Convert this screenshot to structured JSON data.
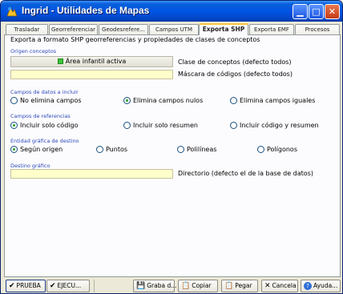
{
  "window": {
    "title": "Ingrid - Utilidades de Mapas",
    "controls": [
      "minimize",
      "maximize",
      "close"
    ]
  },
  "tabs": [
    {
      "label": "Trasladar",
      "active": false
    },
    {
      "label": "Georreferenciar",
      "active": false
    },
    {
      "label": "Geodesrefere...",
      "active": false
    },
    {
      "label": "Campos UTM",
      "active": false
    },
    {
      "label": "Exporta SHP",
      "active": true
    },
    {
      "label": "Exporta EMF",
      "active": false
    },
    {
      "label": "Procesos",
      "active": false
    }
  ],
  "panel": {
    "description": "Exporta a formato SHP georreferencias y propiedades de clases de conceptos",
    "origen": {
      "section_label": "Origen conceptos",
      "area_button": "Área infantil activa",
      "clase_label": "Clase de conceptos (defecto todos)",
      "mascara_value": "",
      "mascara_label": "Máscara de códigos (defecto todos)"
    },
    "campos_datos": {
      "section_label": "Campos de datos a incluir",
      "options": [
        "No elimina campos",
        "Elimina campos nulos",
        "Elimina campos iguales"
      ],
      "selected": 1
    },
    "campos_referencias": {
      "section_label": "Campos de referencias",
      "options": [
        "Incluir solo código",
        "Incluir solo resumen",
        "Incluir código y resumen"
      ],
      "selected": 0
    },
    "entidad": {
      "section_label": "Entidad gráfica de destino",
      "options": [
        "Según origen",
        "Puntos",
        "Polilíneas",
        "Polígonos"
      ],
      "selected": 0
    },
    "destino": {
      "section_label": "Destino gráfico",
      "value": "",
      "label": "Directorio (defecto el de la base de datos)"
    }
  },
  "bottom_buttons": {
    "prueba": "PRUEBA",
    "ejecutar": "EJECU...",
    "graba": "Graba d...",
    "copiar": "Copiar",
    "pegar": "Pegar",
    "cancela": "Cancela",
    "ayuda": "Ayuda..."
  },
  "colors": {
    "titlebar": "#0055e5",
    "section_label": "#2a47b8",
    "input_bg": "#ffffcc",
    "active_tab_accent": "#ffc83c",
    "radio_dot": "#21a121"
  }
}
